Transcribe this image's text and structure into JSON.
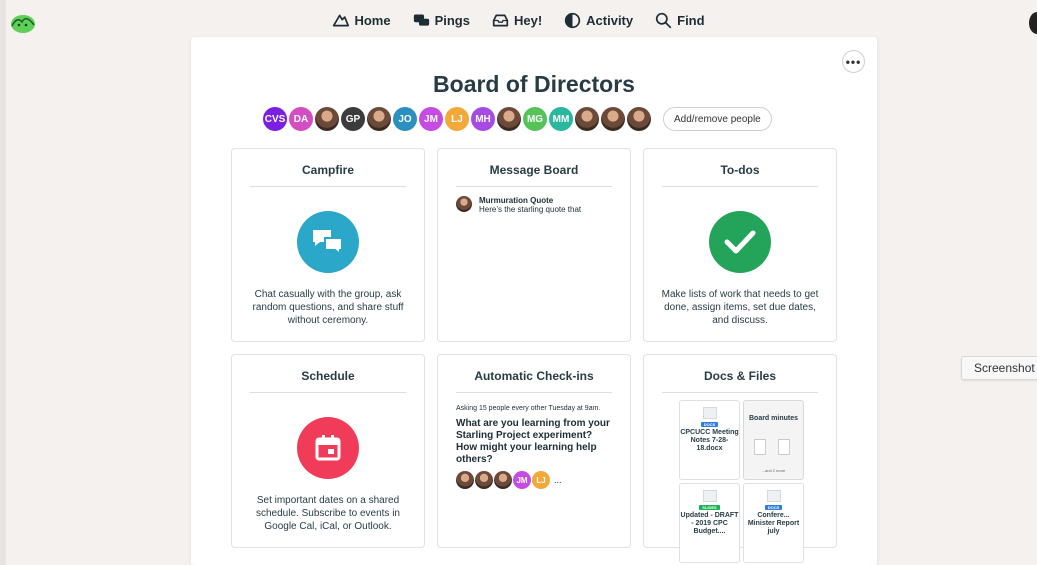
{
  "nav": {
    "home": "Home",
    "pings": "Pings",
    "hey": "Hey!",
    "activity": "Activity",
    "find": "Find"
  },
  "project": {
    "title": "Board of Directors",
    "more": "•••",
    "add_remove": "Add/remove people"
  },
  "people": [
    {
      "initials": "CVS",
      "color": "#7b1fe0"
    },
    {
      "initials": "DA",
      "color": "#d24ec2"
    },
    {
      "initials": "",
      "photo": true
    },
    {
      "initials": "GP",
      "color": "#3c3c3c"
    },
    {
      "initials": "",
      "photo": true
    },
    {
      "initials": "JO",
      "color": "#2b8fbf"
    },
    {
      "initials": "JM",
      "color": "#c64be3"
    },
    {
      "initials": "LJ",
      "color": "#f3a93a"
    },
    {
      "initials": "MH",
      "color": "#a54be3"
    },
    {
      "initials": "",
      "photo": true
    },
    {
      "initials": "MG",
      "color": "#55c35a"
    },
    {
      "initials": "MM",
      "color": "#29b79d"
    },
    {
      "initials": "",
      "photo": true
    },
    {
      "initials": "",
      "photo": true
    },
    {
      "initials": "",
      "photo": true
    }
  ],
  "campfire": {
    "title": "Campfire",
    "desc": "Chat casually with the group, ask random questions, and share stuff without ceremony.",
    "icon_color": "#2aa7c9"
  },
  "message_board": {
    "title": "Message Board",
    "post_title": "Murmuration Quote",
    "post_excerpt": "Here’s the starling quote that"
  },
  "todos": {
    "title": "To-dos",
    "desc": "Make lists of work that needs to get done, assign items, set due dates, and discuss.",
    "icon_color": "#23a45a"
  },
  "schedule": {
    "title": "Schedule",
    "desc": "Set important dates on a shared schedule. Subscribe to events in Google Cal, iCal, or Outlook.",
    "icon_color": "#f03c59"
  },
  "checkins": {
    "title": "Automatic Check-ins",
    "asking": "Asking 15 people every other Tuesday at 9am.",
    "question": "What are you learning from your Starling Project experiment? How might your learning help others?",
    "ellipsis": "...",
    "avatars": [
      {
        "initials": "",
        "photo": true
      },
      {
        "initials": "",
        "photo": true
      },
      {
        "initials": "",
        "photo": true
      },
      {
        "initials": "JM",
        "color": "#c64be3"
      },
      {
        "initials": "LJ",
        "color": "#f3a93a"
      }
    ]
  },
  "docs": {
    "title": "Docs & Files",
    "items": [
      {
        "tag": "DOCS",
        "tag_color": "#2f7de1",
        "name": "CPCUCC Meeting Notes 7-28-18.docx"
      },
      {
        "folder": true,
        "name": "Board minutes",
        "more": "...and 2 more"
      },
      {
        "tag": "SLIDES",
        "tag_color": "#18b153",
        "name": "Updated - DRAFT - 2019 CPC Budget...."
      },
      {
        "tag": "DOCS",
        "tag_color": "#2f7de1",
        "name": "Confere... Minister Report july"
      }
    ]
  },
  "overlay": {
    "screenshot": "Screenshot"
  }
}
